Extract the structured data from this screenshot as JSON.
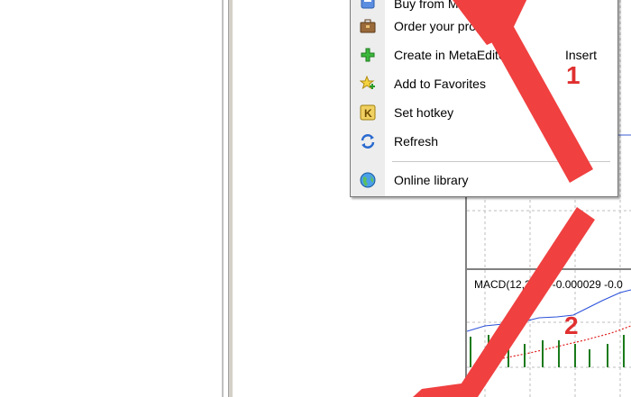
{
  "menu": {
    "items": [
      {
        "label": "Buy from Market",
        "icon": "cart-icon"
      },
      {
        "label": "Order your program",
        "icon": "briefcase-icon"
      },
      {
        "label": "Create in MetaEditor",
        "shortcut": "Insert",
        "icon": "plus-icon"
      },
      {
        "label": "Add to Favorites",
        "icon": "star-add-icon"
      },
      {
        "label": "Set hotkey",
        "icon": "hotkey-icon"
      },
      {
        "label": "Refresh",
        "icon": "refresh-icon"
      },
      {
        "label": "Online library",
        "icon": "globe-icon"
      }
    ]
  },
  "chart": {
    "indicator_label": "MACD(12,26,9) -0.000029 -0.0"
  },
  "annotations": {
    "marker_1": "1",
    "marker_2": "2"
  },
  "colors": {
    "arrow": "#f04040",
    "macd_line": "#2a4fd8",
    "signal_line": "#e02020",
    "histogram": "#1a7a1a"
  }
}
